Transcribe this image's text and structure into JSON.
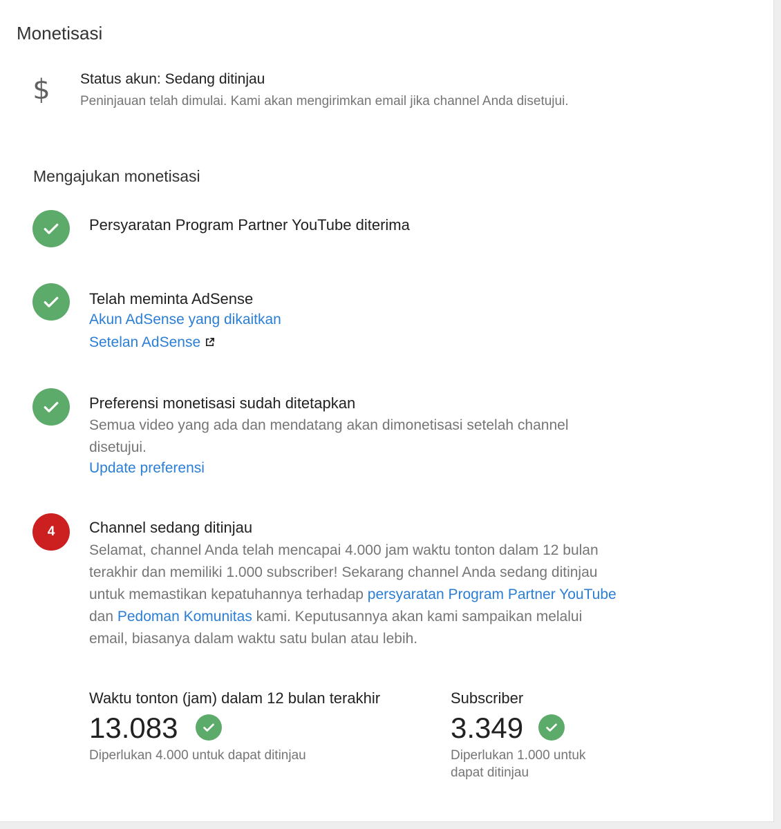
{
  "page_title": "Monetisasi",
  "account_status": {
    "icon": "dollar-icon",
    "title": "Status akun: Sedang ditinjau",
    "description": "Peninjauan telah dimulai. Kami akan mengirimkan email jika channel Anda disetujui."
  },
  "section_title": "Mengajukan monetisasi",
  "steps": [
    {
      "status": "done",
      "title": "Persyaratan Program Partner YouTube diterima"
    },
    {
      "status": "done",
      "title": "Telah meminta AdSense",
      "links": [
        "Akun AdSense yang dikaitkan",
        "Setelan AdSense"
      ]
    },
    {
      "status": "done",
      "title": "Preferensi monetisasi sudah ditetapkan",
      "description": "Semua video yang ada dan mendatang akan dimonetisasi setelah channel disetujui.",
      "link": "Update preferensi"
    },
    {
      "status": "pending",
      "number": "4",
      "title": "Channel sedang ditinjau",
      "description_parts": {
        "p1": "Selamat, channel Anda telah mencapai 4.000 jam waktu tonton dalam 12 bulan terakhir dan memiliki 1.000 subscriber! Sekarang channel Anda sedang ditinjau untuk memastikan kepatuhannya terhadap ",
        "link1": "persyaratan Program Partner YouTube",
        "p2": " dan ",
        "link2": "Pedoman Komunitas",
        "p3": " kami. Keputusannya akan kami sampaikan melalui email, biasanya dalam waktu satu bulan atau lebih."
      }
    }
  ],
  "metrics": [
    {
      "label": "Waktu tonton (jam) dalam 12 bulan terakhir",
      "value": "13.083",
      "note": "Diperlukan 4.000 untuk dapat ditinjau"
    },
    {
      "label": "Subscriber",
      "value": "3.349",
      "note": "Diperlukan 1.000 untuk dapat ditinjau"
    }
  ],
  "colors": {
    "success": "#5cab6a",
    "pending": "#cc1f1f",
    "link": "#2a7ed6",
    "secondary_text": "#757575"
  }
}
